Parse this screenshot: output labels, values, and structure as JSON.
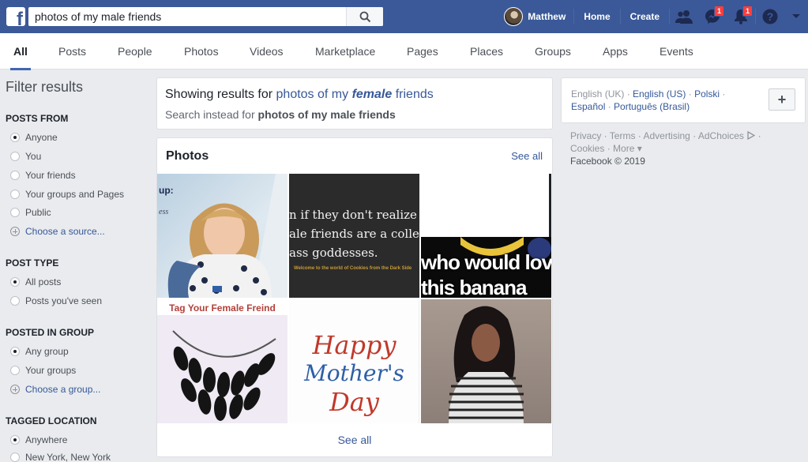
{
  "topbar": {
    "logo": "f",
    "search_value": "photos of my male friends",
    "search_icon": "search-icon",
    "user_name": "Matthew",
    "home_label": "Home",
    "create_label": "Create",
    "messages_badge": "1",
    "notifications_badge": "1",
    "brand_color": "#3b5998"
  },
  "tabs": [
    "All",
    "Posts",
    "People",
    "Photos",
    "Videos",
    "Marketplace",
    "Pages",
    "Places",
    "Groups",
    "Apps",
    "Events"
  ],
  "filters": {
    "title": "Filter results",
    "sections": [
      {
        "head": "POSTS FROM",
        "options": [
          {
            "label": "Anyone",
            "selected": true
          },
          {
            "label": "You"
          },
          {
            "label": "Your friends"
          },
          {
            "label": "Your groups and Pages"
          },
          {
            "label": "Public"
          },
          {
            "label": "Choose a source...",
            "add": true
          }
        ]
      },
      {
        "head": "POST TYPE",
        "options": [
          {
            "label": "All posts",
            "selected": true
          },
          {
            "label": "Posts you've seen"
          }
        ]
      },
      {
        "head": "POSTED IN GROUP",
        "options": [
          {
            "label": "Any group",
            "selected": true
          },
          {
            "label": "Your groups"
          },
          {
            "label": "Choose a group...",
            "add": true
          }
        ]
      },
      {
        "head": "TAGGED LOCATION",
        "options": [
          {
            "label": "Anywhere",
            "selected": true
          },
          {
            "label": "New York, New York"
          }
        ]
      }
    ]
  },
  "showing": {
    "prefix": "Showing results for ",
    "query_start": "photos of my ",
    "query_emph": "female",
    "query_end": " friends",
    "instead_prefix": "Search instead for ",
    "instead_query": "photos of my male friends"
  },
  "photos": {
    "title": "Photos",
    "see_all_top": "See all",
    "see_all_bottom": "See all",
    "tiles": [
      {
        "caption": "up:",
        "caption2": "ess"
      },
      {
        "lines": [
          "n if they don't realize it,",
          "ale friends are a collection",
          "ass goddesses."
        ],
        "small": "Welcome to the world of Cookies from the Dark Side"
      },
      {
        "lines": [
          "who would love",
          "this banana"
        ]
      },
      {
        "caption": "Tag Your Female Freind"
      },
      {
        "lines": [
          "Happy",
          "Mother's",
          "Day"
        ]
      },
      {}
    ]
  },
  "languages": {
    "current": "English (UK)",
    "others": [
      "English (US)",
      "Polski",
      "Español",
      "Português (Brasil)"
    ],
    "add_label": "+"
  },
  "footer": {
    "links": [
      "Privacy",
      "Terms",
      "Advertising",
      "AdChoices",
      "Cookies",
      "More"
    ],
    "copyright": "Facebook © 2019"
  }
}
